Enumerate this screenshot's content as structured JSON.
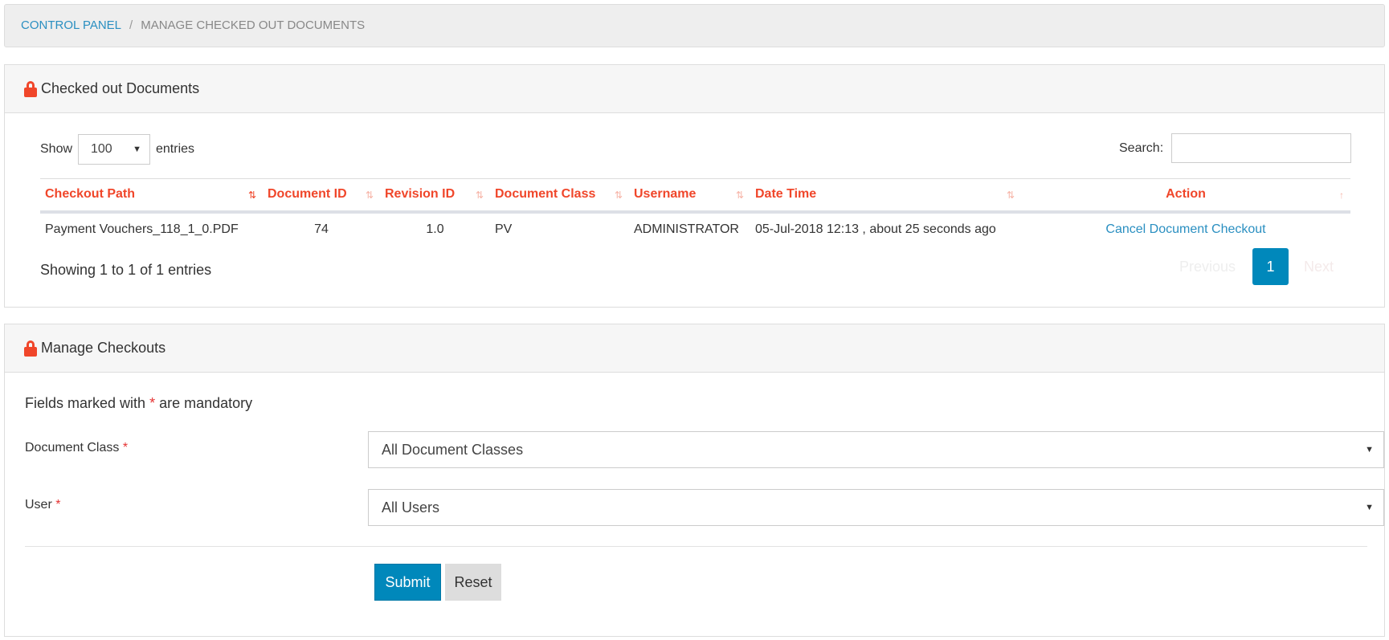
{
  "breadcrumb": {
    "root": "CONTROL PANEL",
    "separator": "/",
    "current": "MANAGE CHECKED OUT DOCUMENTS"
  },
  "checked_out": {
    "title": "Checked out Documents",
    "show_label": "Show",
    "entries_value": "100",
    "entries_label": "entries",
    "search_label": "Search:",
    "search_value": "",
    "columns": [
      "Checkout Path",
      "Document ID",
      "Revision ID",
      "Document Class",
      "Username",
      "Date Time",
      "Action"
    ],
    "rows": [
      {
        "path": "Payment Vouchers_118_1_0.PDF",
        "doc_id": "74",
        "rev_id": "1.0",
        "doc_class": "PV",
        "username": "ADMINISTRATOR",
        "datetime": "05-Jul-2018 12:13 , about 25 seconds ago",
        "action": "Cancel Document Checkout"
      }
    ],
    "info": "Showing 1 to 1 of 1 entries",
    "pagination": {
      "previous": "Previous",
      "page": "1",
      "next": "Next"
    }
  },
  "manage": {
    "title": "Manage Checkouts",
    "mandatory_pre": "Fields marked with",
    "mandatory_star": "*",
    "mandatory_post": "are mandatory",
    "doc_class_label": "Document Class",
    "doc_class_value": "All Document Classes",
    "user_label": "User",
    "user_value": "All Users",
    "submit": "Submit",
    "reset": "Reset"
  },
  "colors": {
    "accent": "#f0462a",
    "primary": "#0088bb",
    "link": "#2a8fc1"
  }
}
